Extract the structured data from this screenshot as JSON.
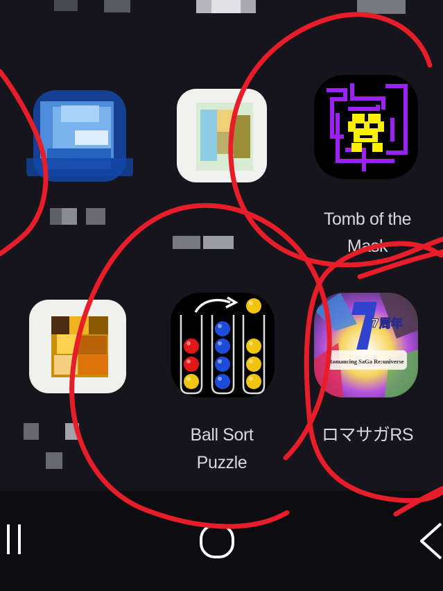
{
  "apps": [
    {
      "label_line1": "Tomb of the",
      "label_line2": "Mask",
      "icon": "tomb-of-the-mask-icon"
    },
    {
      "label_line1": "Ball Sort",
      "label_line2": "Puzzle",
      "icon": "ball-sort-puzzle-icon"
    },
    {
      "label": "ロマサガRS",
      "icon": "romancing-saga-rs-icon",
      "icon_text": "Romancing SaGa Re:universe",
      "icon_badge": "7周年"
    }
  ],
  "navigation": {
    "recents": "recents-icon",
    "home": "home-icon",
    "back": "back-icon"
  },
  "colors": {
    "background": "#15151b",
    "annotation_red": "#e81d2a",
    "tomb_maze_purple": "#9b21f4",
    "tomb_mask_yellow": "#fff100",
    "ball_red": "#e21818",
    "ball_blue": "#1d4dd8",
    "ball_yellow": "#f1c40f"
  }
}
